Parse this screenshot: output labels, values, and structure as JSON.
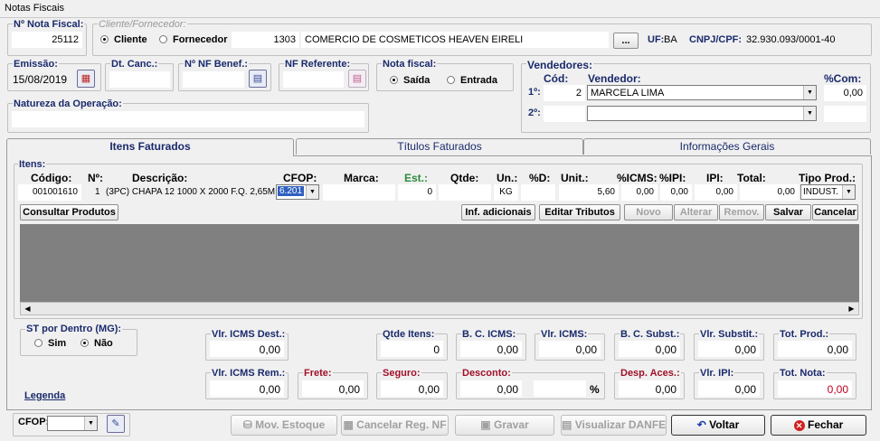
{
  "window": {
    "title": "Notas Fiscais"
  },
  "header": {
    "nota_fiscal_label": "Nº Nota Fiscal:",
    "nota_fiscal_value": "25112",
    "cliente_fornecedor_label": "Cliente/Fornecedor:",
    "cliente_label": "Cliente",
    "fornecedor_label": "Fornecedor",
    "cliente_codigo": "1303",
    "cliente_nome": "COMERCIO DE COSMETICOS HEAVEN EIRELI",
    "browse_label": "...",
    "uf_label": "UF:",
    "uf_value": "BA",
    "cnpj_label": "CNPJ/CPF:",
    "cnpj_value": "32.930.093/0001-40"
  },
  "row2": {
    "emissao_label": "Emissão:",
    "emissao_value": "15/08/2019",
    "dt_canc_label": "Dt. Canc.:",
    "nf_benef_label": "Nº NF Benef.:",
    "nf_ref_label": "NF Referente:",
    "nota_fiscal_tipo_label": "Nota fiscal:",
    "saida_label": "Saída",
    "entrada_label": "Entrada",
    "natureza_label": "Natureza da Operação:"
  },
  "vendedores": {
    "label": "Vendedores:",
    "cod_label": "Cód:",
    "vendedor_label": "Vendedor:",
    "com_label": "%Com:",
    "row1_label": "1º:",
    "row1_cod": "2",
    "row1_nome": "MARCELA LIMA",
    "row1_com": "0,00",
    "row2_label": "2º:"
  },
  "tabs": [
    {
      "label": "Itens Faturados"
    },
    {
      "label": "Títulos Faturados"
    },
    {
      "label": "Informações Gerais"
    }
  ],
  "itens": {
    "label": "Itens:",
    "headers": {
      "codigo": "Código:",
      "numero": "Nº:",
      "descricao": "Descrição:",
      "cfop": "CFOP:",
      "marca": "Marca:",
      "est": "Est.:",
      "qtde": "Qtde:",
      "un": "Un.:",
      "pd": "%D:",
      "unit": "Unit.:",
      "icms": "%ICMS:",
      "ipi_pct": "%IPI:",
      "ipi": "IPI:",
      "total": "Total:",
      "tipo_prod": "Tipo Prod.:"
    },
    "row": {
      "codigo": "001001610",
      "numero": "1",
      "descricao": "(3PC) CHAPA 12 1000 X 2000 F.Q. 2,65M",
      "cfop": "6.201",
      "marca": "",
      "est": "0",
      "qtde": "",
      "un": "KG",
      "pd": "",
      "unit": "5,60",
      "icms": "0,00",
      "ipi_pct": "0,00",
      "ipi": "0,00",
      "total": "0,00",
      "tipo_prod": "INDUST."
    },
    "buttons": {
      "consultar": "Consultar Produtos",
      "inf_adicionais": "Inf. adicionais",
      "editar_tributos": "Editar Tributos",
      "novo": "Novo",
      "alterar": "Alterar",
      "remover": "Remov.",
      "salvar": "Salvar",
      "cancelar": "Cancelar"
    }
  },
  "st": {
    "label": "ST por Dentro (MG):",
    "sim": "Sim",
    "nao": "Não"
  },
  "totals": {
    "vlr_icms_dest_label": "Vlr. ICMS Dest.:",
    "vlr_icms_dest": "0,00",
    "qtde_itens_label": "Qtde Itens:",
    "qtde_itens": "0",
    "bc_icms_label": "B. C. ICMS:",
    "bc_icms": "0,00",
    "vlr_icms_label": "Vlr. ICMS:",
    "vlr_icms": "0,00",
    "bc_subst_label": "B. C. Subst.:",
    "bc_subst": "0,00",
    "vlr_substit_label": "Vlr. Substit.:",
    "vlr_substit": "0,00",
    "tot_prod_label": "Tot. Prod.:",
    "tot_prod": "0,00",
    "vlr_icms_rem_label": "Vlr. ICMS Rem.:",
    "vlr_icms_rem": "0,00",
    "frete_label": "Frete:",
    "frete": "0,00",
    "seguro_label": "Seguro:",
    "seguro": "0,00",
    "desconto_label": "Desconto:",
    "desconto": "0,00",
    "desconto_pct_symbol": "%",
    "desp_aces_label": "Desp. Aces.:",
    "desp_aces": "0,00",
    "vlr_ipi_label": "Vlr. IPI:",
    "vlr_ipi": "0,00",
    "tot_nota_label": "Tot. Nota:",
    "tot_nota": "0,00"
  },
  "legenda": "Legenda",
  "footer": {
    "cfop_label": "CFOP:",
    "mov_estoque": "Mov. Estoque",
    "cancelar_reg": "Cancelar Reg. NF",
    "gravar": "Gravar",
    "visualizar_danfe": "Visualizar DANFE",
    "voltar": "Voltar",
    "fechar": "Fechar"
  },
  "colors": {
    "label_blue": "#1a2a6c",
    "label_red": "#a0102a",
    "est_green": "#2e8b3e",
    "grid_gray": "#808080"
  }
}
